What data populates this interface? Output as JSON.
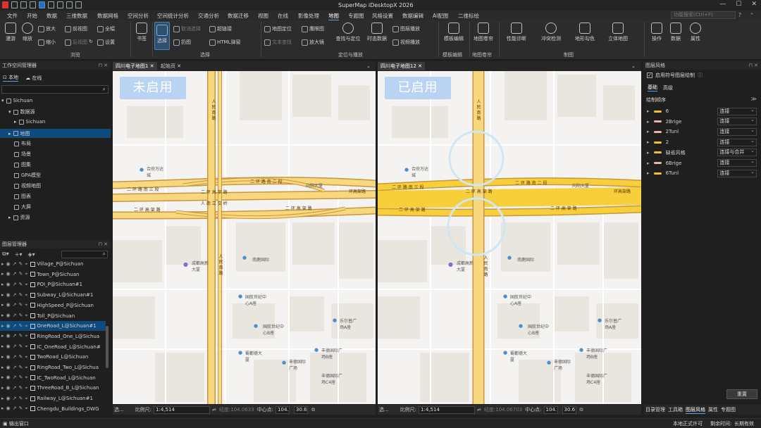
{
  "app": {
    "title": "SuperMap iDesktopX 2026",
    "minimize": "—",
    "maximize": "☐",
    "close": "✕"
  },
  "menu": {
    "items": [
      "文件",
      "开始",
      "数据",
      "三维数据",
      "数据网格",
      "空间分析",
      "空间统计分析",
      "交通分析",
      "数据迁移",
      "视图",
      "在线",
      "影像处理",
      "地图",
      "专题图",
      "风格设置",
      "数据编辑",
      "AI配图",
      "二维标绘"
    ],
    "active_index": 12,
    "search_placeholder": "功能搜索(Ctrl+F)"
  },
  "ribbon": {
    "browse": {
      "roam": "漫游",
      "zoom": "缩放",
      "zoom_in": "放大",
      "zoom_out": "缩小",
      "prev_view": "前视图",
      "next_view": "后视图",
      "full": "全幅",
      "refresh": "刷新",
      "settings": "设置",
      "group": "浏览"
    },
    "bookmark": "书签",
    "select": {
      "select": "选择",
      "cancel_select": "取消选择",
      "pan": "扔图",
      "hyperlink": "超链接",
      "html_popup": "HTML弹窗",
      "group": "选择"
    },
    "locate": {
      "map_locate": "地图定位",
      "text_search": "文本查找",
      "eagle_eye": "鹰眼图",
      "magnifier": "放大镜",
      "find_locate": "查找与定位",
      "timeseries": "时态数据",
      "layer_play": "图层播放",
      "video_play": "视频播放",
      "group": "定位与播放"
    },
    "template": {
      "edit": "模板编辑",
      "group": "模板编辑"
    },
    "map_roll": {
      "label": "地图卷帘",
      "group": "地图卷帘"
    },
    "cartography": {
      "perf": "性能诊断",
      "conflict": "冲突检测",
      "terrain": "地形勾色",
      "three_d": "立体地图",
      "group": "制图"
    },
    "right": {
      "ops": "操作",
      "data": "数据",
      "prop": "属性"
    }
  },
  "workspace": {
    "title": "工作空间管理器",
    "tabs": [
      "本地",
      "在线"
    ],
    "tree": [
      {
        "label": "Sichuan",
        "level": 0
      },
      {
        "label": "数据源",
        "level": 1
      },
      {
        "label": "Sichuan",
        "level": 2
      },
      {
        "label": "地图",
        "level": 1,
        "selected": true
      },
      {
        "label": "布局",
        "level": 1
      },
      {
        "label": "场景",
        "level": 1
      },
      {
        "label": "图集",
        "level": 1
      },
      {
        "label": "GPA模型",
        "level": 1
      },
      {
        "label": "视频地图",
        "level": 1
      },
      {
        "label": "图表",
        "level": 1
      },
      {
        "label": "大屏",
        "level": 1
      },
      {
        "label": "资源",
        "level": 1
      }
    ]
  },
  "layer_manager": {
    "title": "图层管理器",
    "layers": [
      {
        "name": "Village_P@Sichuan",
        "selected": false
      },
      {
        "name": "Town_P@Sichuan",
        "selected": false
      },
      {
        "name": "POI_P@Sichuan#1",
        "selected": false
      },
      {
        "name": "Subway_L@Sichuan#1",
        "selected": false
      },
      {
        "name": "HighSpeed_P@Sichuan",
        "selected": false
      },
      {
        "name": "Toll_P@Sichuan",
        "selected": false
      },
      {
        "name": "OneRoad_L@Sichuan#1",
        "selected": true
      },
      {
        "name": "RingRoad_One_L@Sichua",
        "selected": false
      },
      {
        "name": "IC_OneRoad_L@Sichuan#",
        "selected": false
      },
      {
        "name": "TwoRoad_L@Sichuan",
        "selected": false
      },
      {
        "name": "RingRoad_Two_L@Sichua",
        "selected": false
      },
      {
        "name": "IC_TwoRoad_L@Sichuan",
        "selected": false
      },
      {
        "name": "ThreeRoad_B_L@Sichuan",
        "selected": false
      },
      {
        "name": "Railway_L@Sichuan#1",
        "selected": false
      },
      {
        "name": "Chengdu_Buildings_DWG",
        "selected": false
      }
    ]
  },
  "left_map": {
    "tabs": [
      "四川电子地图1",
      "起始页"
    ],
    "badge": "未启用",
    "labels": {
      "road1": "二 环 路 南 三 段",
      "road2": "二 环 高 架 路",
      "road3": "二 环 路 南 二 段",
      "road4": "人 南 立 交 桥",
      "road5": "二 环 高 架 路",
      "road6": "二 环 高 架 路",
      "road7": "环高架路",
      "road8": "人 民 南 路",
      "road9": "人 民 南 路",
      "poi1": "向阳大厦",
      "poi2": "成都高新大厦",
      "poi3": "合府万达城",
      "poi4": "南鹿国际",
      "poi5": "国航世纪中心A座",
      "poi6": "国航世纪中心B座",
      "poi7": "乐尔普广场A座",
      "poi8": "蜀都德大厦",
      "poi9": "丰德国际广场",
      "poi10": "丰德国际广场B座",
      "poi11": "丰德国际广场C4座"
    },
    "status": {
      "select_label": "选...",
      "scale_label": "比例尺:",
      "scale": "1:4,514",
      "coord_label": "经度:104.0633",
      "center_label": "中心点:",
      "center_x": "104.",
      "center_y": "30.6"
    }
  },
  "right_map": {
    "tabs": [
      "四川电子地图12"
    ],
    "badge": "已启用",
    "labels": {
      "road1": "二 环 路 南 三 段",
      "road2": "二 环 高 架 路",
      "road3": "二 环 路 南 二 段",
      "road5": "二 环 高 架 路",
      "road6": "二 环 高 架 路",
      "road7": "环高架路",
      "road8": "人 民 南 路",
      "road9": "人 民 南 路",
      "poi1": "向阳大厦",
      "poi2": "成都高新大厦",
      "poi3": "合府万达城",
      "poi4": "南鹿国际",
      "poi5": "国航世纪中心A座",
      "poi6": "国航世纪中心B座",
      "poi7": "乐尔普广场A座",
      "poi8": "蜀都德大厦",
      "poi9": "丰德国际广场",
      "poi10": "丰德国际广场B座",
      "poi11": "丰德国际广场C4座"
    },
    "status": {
      "select_label": "选...",
      "scale_label": "比例尺:",
      "scale": "1:4,514",
      "coord_label": "经度:104.06703",
      "center_label": "中心点:",
      "center_x": "104.",
      "center_y": "30.6"
    }
  },
  "style_panel": {
    "title": "图层风格",
    "enable_checkbox": "启用符号图层绘制",
    "tabs": [
      "基础",
      "高级"
    ],
    "order_label": "绘制顺序",
    "rows": [
      {
        "name": "6",
        "mode": "连接",
        "color": "#f2c030"
      },
      {
        "name": "2Brige",
        "mode": "连接",
        "color": "#e8b8b0"
      },
      {
        "name": "2Tunl",
        "mode": "连接",
        "color": "#e8b8b0"
      },
      {
        "name": "2",
        "mode": "连接",
        "color": "#f2c030"
      },
      {
        "name": "缺省风格",
        "mode": "连接与合并",
        "color": "#f2c030"
      },
      {
        "name": "6Brige",
        "mode": "连接",
        "color": "#e8b8b0"
      },
      {
        "name": "6Tunl",
        "mode": "连接",
        "color": "#f2c030"
      }
    ],
    "reset": "重置",
    "bottom_tabs": [
      "目录管理",
      "工具箱",
      "图层风格",
      "属性",
      "专题图"
    ]
  },
  "statusbar": {
    "output": "输出窗口",
    "license": "本地正式许可",
    "remaining_label": "剩余时间:",
    "remaining": "长期有效"
  }
}
